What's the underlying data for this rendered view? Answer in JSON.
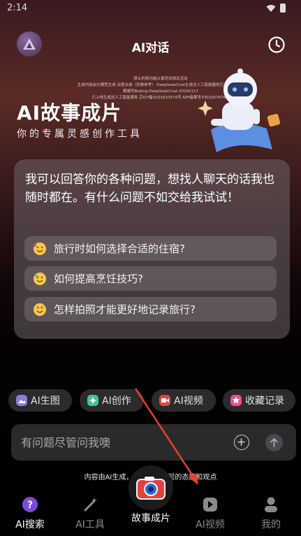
{
  "status_bar": {
    "time": "2:14"
  },
  "header": {
    "title": "AI对话"
  },
  "banner": {
    "notes": [
      "禁止利用功能从事违法相关活动",
      "生成内容由大模型生成 深度合成（仅做参考） DeepSeekChat生成式人工智能服务已完成备案 备案编号Beijing-DeepSeekChat-20240117",
      "已上线生成式人工智能服务 京ICP备2023010574号 APP备案号3301057476号"
    ],
    "title": "AI故事成片",
    "subtitle": "你的专属灵感创作工具"
  },
  "chat": {
    "intro": "我可以回答你的各种问题，想找人聊天的话我也随时都在。有什么问题不如交给我试试！",
    "suggestions": [
      {
        "label": "旅行时如何选择合适的住宿?",
        "icon": "emoji-smile-hearts-icon"
      },
      {
        "label": "如何提高烹饪技巧?",
        "icon": "emoji-party-icon"
      },
      {
        "label": "怎样拍照才能更好地记录旅行?",
        "icon": "emoji-heart-eyes-icon"
      }
    ]
  },
  "quick_actions": [
    {
      "label": "AI生图",
      "icon": "image-gen-icon",
      "color": "#8e7ad8"
    },
    {
      "label": "AI创作",
      "icon": "create-icon",
      "color": "#3ec78e"
    },
    {
      "label": "AI视频",
      "icon": "video-icon",
      "color": "#e0454a"
    },
    {
      "label": "收藏记录",
      "icon": "star-icon",
      "color": "#e8508a"
    }
  ],
  "input": {
    "placeholder": "有问题尽管问我噢"
  },
  "disclaimer": "内容由AI生成，不代表本公司的态度和观点",
  "nav": {
    "items": [
      {
        "label": "AI搜索",
        "active": true
      },
      {
        "label": "AI工具",
        "active": false
      },
      {
        "label": "AI视频",
        "active": false
      },
      {
        "label": "我的",
        "active": false
      }
    ],
    "center_label": "故事成片"
  },
  "colors": {
    "accent": "#8e5bd8",
    "annotation_arrow": "#e8402a"
  }
}
